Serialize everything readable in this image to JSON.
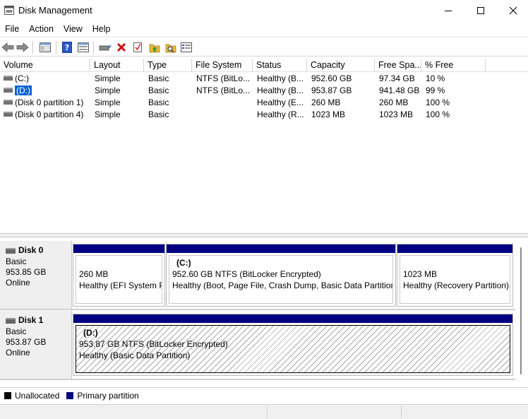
{
  "window": {
    "title": "Disk Management"
  },
  "menu": [
    "File",
    "Action",
    "View",
    "Help"
  ],
  "toolbar": {
    "icons": [
      "back-arrow-icon",
      "forward-arrow-icon",
      "console-tree-icon",
      "help-icon",
      "properties-icon",
      "connect-drive-icon",
      "delete-icon",
      "check-icon",
      "folder-up-icon",
      "folder-search-icon",
      "details-icon"
    ],
    "colors": {
      "delete": "#d01010",
      "folder": "#e9b53a",
      "help": "#2a58c8"
    }
  },
  "volume_list": {
    "columns": [
      "Volume",
      "Layout",
      "Type",
      "File System",
      "Status",
      "Capacity",
      "Free Spa...",
      "% Free"
    ],
    "rows": [
      {
        "volume": "(C:)",
        "layout": "Simple",
        "type": "Basic",
        "fs": "NTFS (BitLo...",
        "status": "Healthy (B...",
        "capacity": "952.60 GB",
        "free": "97.34 GB",
        "pct": "10 %"
      },
      {
        "volume": "(D:)",
        "layout": "Simple",
        "type": "Basic",
        "fs": "NTFS (BitLo...",
        "status": "Healthy (B...",
        "capacity": "953.87 GB",
        "free": "941.48 GB",
        "pct": "99 %"
      },
      {
        "volume": "(Disk 0 partition 1)",
        "layout": "Simple",
        "type": "Basic",
        "fs": "",
        "status": "Healthy (E...",
        "capacity": "260 MB",
        "free": "260 MB",
        "pct": "100 %"
      },
      {
        "volume": "(Disk 0 partition 4)",
        "layout": "Simple",
        "type": "Basic",
        "fs": "",
        "status": "Healthy (R...",
        "capacity": "1023 MB",
        "free": "1023 MB",
        "pct": "100 %"
      }
    ],
    "selected_row": 1
  },
  "disks": [
    {
      "name": "Disk 0",
      "kind": "Basic",
      "size": "953.85 GB",
      "state": "Online",
      "partitions": [
        {
          "name": "",
          "size_line": "260 MB",
          "status_line": "Healthy (EFI System Pa"
        },
        {
          "name": "(C:)",
          "size_line": "952.60 GB NTFS (BitLocker Encrypted)",
          "status_line": "Healthy (Boot, Page File, Crash Dump, Basic Data Partition)"
        },
        {
          "name": "",
          "size_line": "1023 MB",
          "status_line": "Healthy (Recovery Partition)"
        }
      ]
    },
    {
      "name": "Disk 1",
      "kind": "Basic",
      "size": "953.87 GB",
      "state": "Online",
      "partitions": [
        {
          "name": "(D:)",
          "size_line": "953.87 GB NTFS (BitLocker Encrypted)",
          "status_line": "Healthy (Basic Data Partition)"
        }
      ]
    }
  ],
  "legend": [
    {
      "label": "Unallocated",
      "color": "#000000"
    },
    {
      "label": "Primary partition",
      "color": "#000080"
    }
  ],
  "colors": {
    "partition_bar": "#000080",
    "selection": "#0a64d3"
  }
}
